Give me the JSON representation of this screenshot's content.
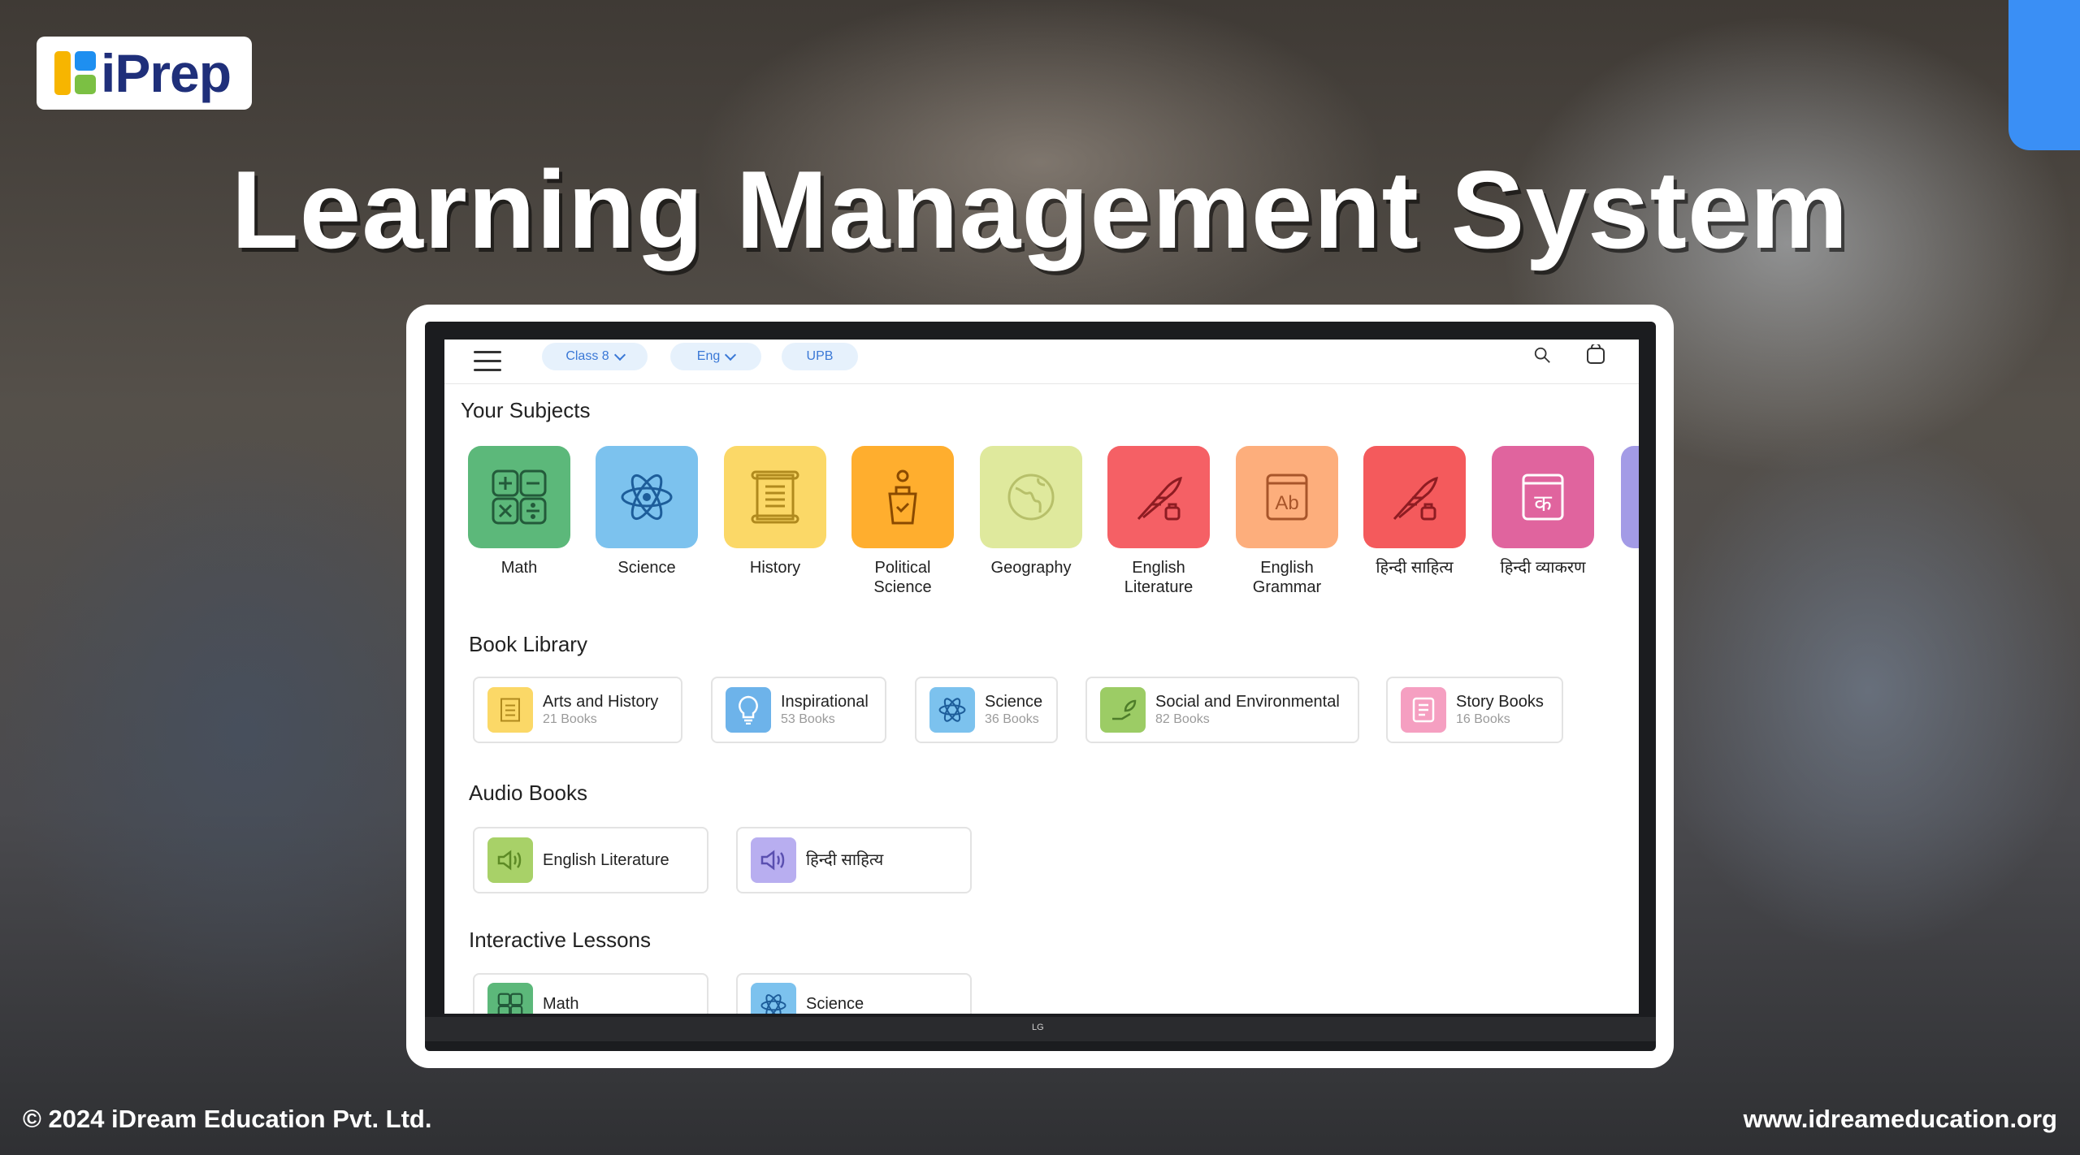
{
  "brand": {
    "logo_text": "iPrep"
  },
  "headline": "Learning Management System",
  "app": {
    "chips": [
      {
        "label": "Class 8",
        "has_dropdown": true
      },
      {
        "label": "Eng",
        "has_dropdown": true
      },
      {
        "label": "UPB",
        "has_dropdown": false
      }
    ],
    "subjects_title": "Your Subjects",
    "subjects": [
      {
        "label": "Math",
        "color": "#5cb87a",
        "icon": "calculator-icon"
      },
      {
        "label": "Science",
        "color": "#7cc2ee",
        "icon": "atom-icon"
      },
      {
        "label": "History",
        "color": "#fbd867",
        "icon": "scroll-icon"
      },
      {
        "label": "Political Science",
        "color": "#ffae2e",
        "icon": "podium-icon"
      },
      {
        "label": "Geography",
        "color": "#dfe99d",
        "icon": "globe-icon"
      },
      {
        "label": "English Literature",
        "color": "#f56065",
        "icon": "quill-icon"
      },
      {
        "label": "English Grammar",
        "color": "#fdae7c",
        "icon": "grammar-book-icon"
      },
      {
        "label": "हिन्दी साहित्य",
        "color": "#f45a5c",
        "icon": "quill-icon"
      },
      {
        "label": "हिन्दी व्याकरण",
        "color": "#e0649e",
        "icon": "hindi-book-icon"
      }
    ],
    "library_title": "Book Library",
    "library": [
      {
        "title": "Arts and History",
        "count": "21 Books",
        "color": "#fbd867",
        "icon": "scroll-icon"
      },
      {
        "title": "Inspirational",
        "count": "53 Books",
        "color": "#6db3ea",
        "icon": "bulb-icon"
      },
      {
        "title": "Science",
        "count": "36 Books",
        "color": "#7cc2ee",
        "icon": "atom-icon"
      },
      {
        "title": "Social and Environmental",
        "count": "82 Books",
        "color": "#9ccc65",
        "icon": "plant-icon"
      },
      {
        "title": "Story Books",
        "count": "16 Books",
        "color": "#f59fc1",
        "icon": "book-icon"
      }
    ],
    "audio_title": "Audio Books",
    "audio": [
      {
        "title": "English Literature",
        "color": "#a8d168",
        "icon": "speaker-icon"
      },
      {
        "title": "हिन्दी साहित्य",
        "color": "#b8aef0",
        "icon": "speaker-icon"
      }
    ],
    "lessons_title": "Interactive Lessons",
    "lessons": [
      {
        "title": "Math",
        "color": "#5cb87a",
        "icon": "calculator-icon"
      },
      {
        "title": "Science",
        "color": "#7cc2ee",
        "icon": "atom-icon"
      }
    ]
  },
  "device_brand": "LG",
  "footer": {
    "copyright": "© 2024 iDream Education Pvt. Ltd.",
    "website": "www.idreameducation.org"
  }
}
